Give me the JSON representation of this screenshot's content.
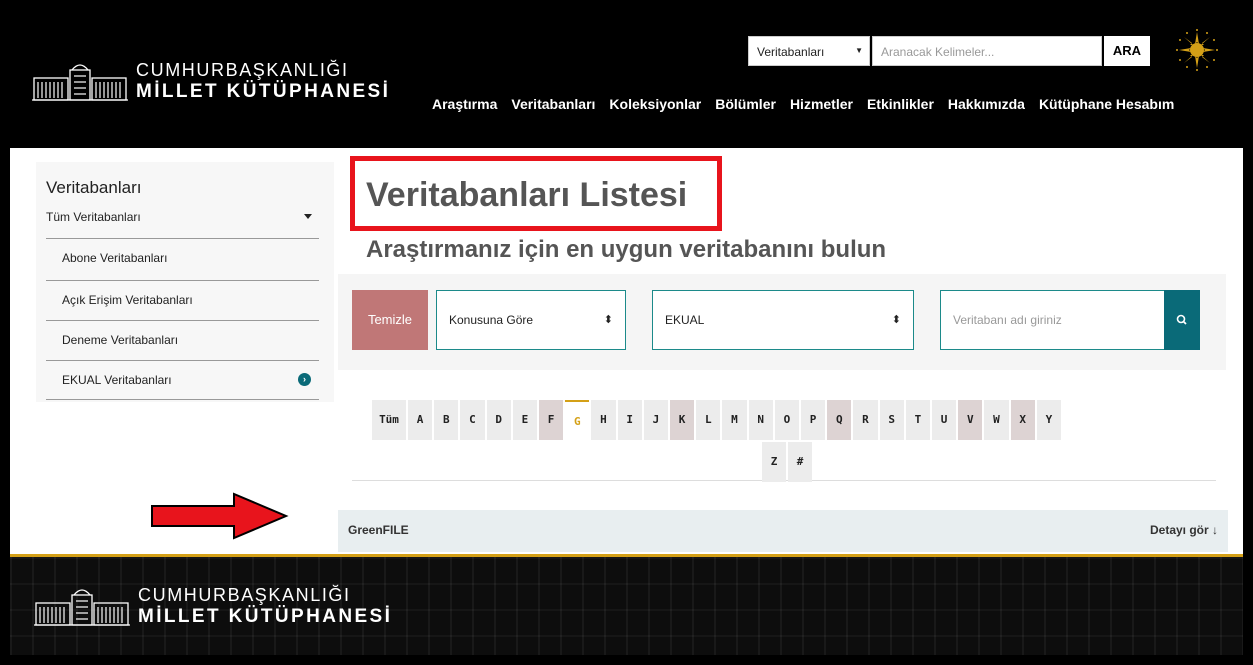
{
  "header": {
    "logo_line1": "CUMHURBAŞKANLIĞI",
    "logo_line2": "MİLLET KÜTÜPHANESİ",
    "search_select": "Veritabanları",
    "search_placeholder": "Aranacak Kelimeler...",
    "search_button": "ARA",
    "nav": [
      "Araştırma",
      "Veritabanları",
      "Koleksiyonlar",
      "Bölümler",
      "Hizmetler",
      "Etkinlikler",
      "Hakkımızda",
      "Kütüphane Hesabım"
    ]
  },
  "sidebar": {
    "title": "Veritabanları",
    "subtitle": "Tüm Veritabanları",
    "items": [
      "Abone Veritabanları",
      "Açık Erişim Veritabanları",
      "Deneme Veritabanları",
      "EKUAL Veritabanları"
    ]
  },
  "main": {
    "title": "Veritabanları Listesi",
    "subtitle": "Araştırmanız için en uygun veritabanını bulun",
    "clear_button": "Temizle",
    "subject_select": "Konusuna Göre",
    "source_select": "EKUAL",
    "name_placeholder": "Veritabanı adı giriniz",
    "letters": [
      "Tüm",
      "A",
      "B",
      "C",
      "D",
      "E",
      "F",
      "G",
      "H",
      "I",
      "J",
      "K",
      "L",
      "M",
      "N",
      "O",
      "P",
      "Q",
      "R",
      "S",
      "T",
      "U",
      "V",
      "W",
      "X",
      "Y",
      "Z",
      "#"
    ],
    "active_letter": "G",
    "result_name": "GreenFILE",
    "result_detail": "Detayı gör ↓"
  },
  "footer": {
    "logo_line1": "CUMHURBAŞKANLIĞI",
    "logo_line2": "MİLLET KÜTÜPHANESİ"
  },
  "colors": {
    "accent": "#0a6a78",
    "gold": "#d4a017",
    "highlight": "#e8141c",
    "clear_button": "#c07777"
  }
}
